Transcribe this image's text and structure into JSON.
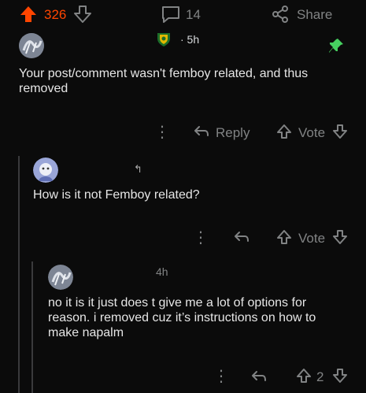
{
  "post_bar": {
    "score": "326",
    "comments": "14",
    "share_label": "Share"
  },
  "mod_comment": {
    "time": "· 5h",
    "text": "Your post/comment wasn't femboy related, and thus removed",
    "reply_label": "Reply",
    "vote_label": "Vote"
  },
  "reply_one": {
    "text": "How is it not Femboy related?",
    "vote_label": "Vote"
  },
  "reply_two": {
    "time": "4h",
    "text": "no it is it just does t give me a lot of options for reason. i removed cuz it’s instructions on how to make napalm",
    "score": "2"
  },
  "colors": {
    "upvote_active": "#ff4500",
    "pin": "#46d160",
    "muted": "#818384"
  }
}
